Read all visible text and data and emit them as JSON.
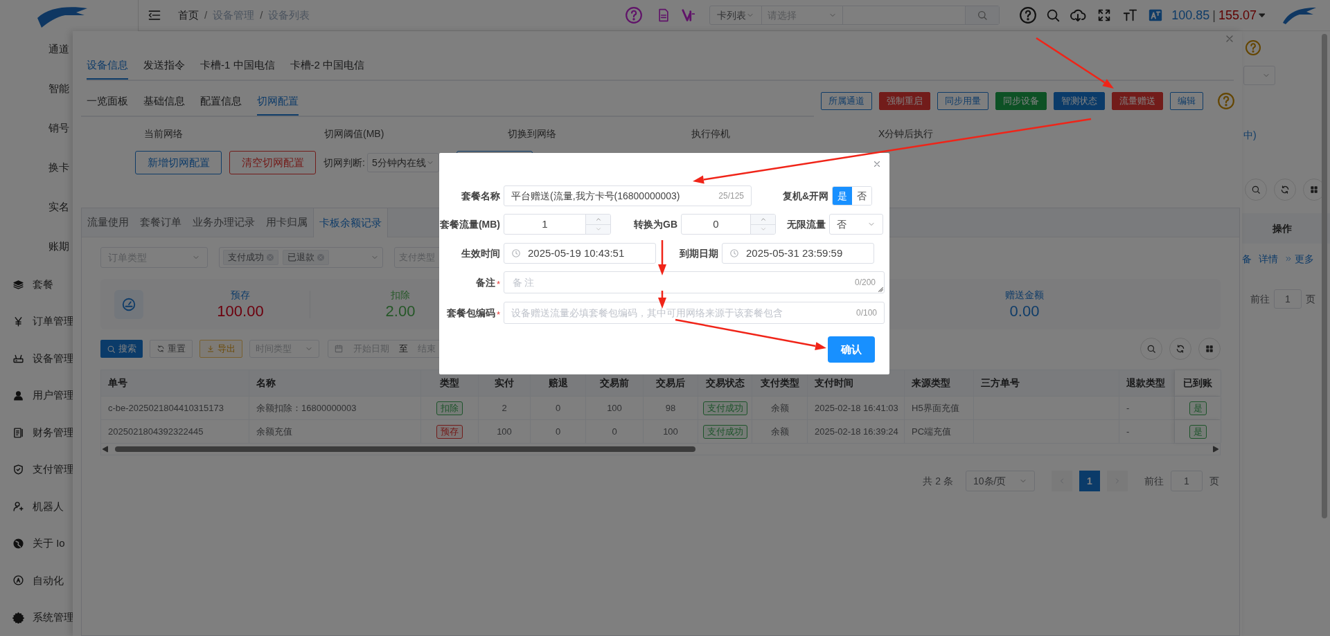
{
  "sidebar": {
    "sub_items": [
      "通道",
      "智能",
      "销号",
      "换卡",
      "实名",
      "账期"
    ],
    "items": [
      "套餐",
      "订单管理",
      "设备管理",
      "用户管理",
      "财务管理",
      "支付管理",
      "机器人",
      "关于 Io",
      "自动化",
      "系统管理"
    ]
  },
  "topbar": {
    "breadcrumb": [
      "首页",
      "设备管理",
      "设备列表"
    ],
    "breadcrumb_separator": "/",
    "search_scope": "卡列表",
    "search_select_placeholder": "请选择",
    "balance": "100.85",
    "balance_separator": "|",
    "balance_2": "155.07"
  },
  "background_page": {
    "link_text": "中)",
    "column_header": "操作",
    "row_actions": [
      "备",
      "详情",
      "更多"
    ],
    "goto_label": "前往",
    "goto_value": "1",
    "page_unit": "页"
  },
  "drawer": {
    "tabs": [
      {
        "label": "设备信息",
        "selected": true
      },
      {
        "label": "发送指令",
        "selected": false
      },
      {
        "label": "卡槽-1 中国电信",
        "selected": false
      },
      {
        "label": "卡槽-2 中国电信",
        "selected": false
      }
    ],
    "subtabs": [
      {
        "label": "一览面板",
        "selected": false
      },
      {
        "label": "基础信息",
        "selected": false
      },
      {
        "label": "配置信息",
        "selected": false
      },
      {
        "label": "切网配置",
        "selected": true
      }
    ],
    "action_buttons": [
      {
        "label": "所属通道",
        "kind": "outline"
      },
      {
        "label": "强制重启",
        "kind": "danger"
      },
      {
        "label": "同步用量",
        "kind": "outline"
      },
      {
        "label": "同步设备",
        "kind": "success"
      },
      {
        "label": "智测状态",
        "kind": "primary"
      },
      {
        "label": "流量赠送",
        "kind": "danger"
      },
      {
        "label": "编辑",
        "kind": "outline"
      }
    ],
    "switch_columns": [
      "当前网络",
      "切网阈值(MB)",
      "切换到网络",
      "执行停机",
      "X分钟后执行"
    ],
    "add_button": "新增切网配置",
    "clear_button": "清空切网配置",
    "judge_label": "切网判断:",
    "judge_value": "5分钟内在线",
    "record_tabs": [
      {
        "label": "流量使用",
        "selected": false
      },
      {
        "label": "套餐订单",
        "selected": false
      },
      {
        "label": "业务办理记录",
        "selected": false
      },
      {
        "label": "用卡归属",
        "selected": false
      },
      {
        "label": "卡板余额记录",
        "selected": true
      }
    ],
    "filters": {
      "order_type_placeholder": "订单类型",
      "status_tags": [
        "支付成功",
        "已退款"
      ],
      "pay_type_placeholder": "支付类型"
    },
    "stats": [
      {
        "label": "预存",
        "value": "100.00",
        "kind": "deposit"
      },
      {
        "label": "扣除",
        "value": "2.00",
        "kind": "deduct"
      },
      {
        "label": "赠送金额",
        "value": "0.00",
        "kind": "gift"
      }
    ],
    "toolbar": {
      "search_button": "搜索",
      "reset_button": "重置",
      "export_button": "导出",
      "time_type_placeholder": "时间类型",
      "start_placeholder": "开始日期",
      "range_separator": "至",
      "end_placeholder": "结束"
    },
    "table": {
      "columns": [
        "单号",
        "名称",
        "类型",
        "实付",
        "赔退",
        "交易前",
        "交易后",
        "交易状态",
        "支付类型",
        "支付时间",
        "来源类型",
        "三方单号",
        "退款类型",
        "已到账"
      ],
      "rows": [
        [
          {
            "text": "c-be-2025021804410315173"
          },
          {
            "text": "余额扣除：16800000003"
          },
          {
            "text": "扣除",
            "kind": "success_tag"
          },
          {
            "text": "2"
          },
          {
            "text": "0"
          },
          {
            "text": "100"
          },
          {
            "text": "98"
          },
          {
            "text": "支付成功",
            "kind": "success_tag"
          },
          {
            "text": "余额"
          },
          {
            "text": "2025-02-18 16:41:03"
          },
          {
            "text": "H5界面充值"
          },
          {
            "text": ""
          },
          {
            "text": "-"
          },
          {
            "text": "是",
            "kind": "success_tag"
          }
        ],
        [
          {
            "text": "2025021804392322445"
          },
          {
            "text": "余额充值"
          },
          {
            "text": "预存",
            "kind": "danger_tag"
          },
          {
            "text": "100"
          },
          {
            "text": "0"
          },
          {
            "text": "0"
          },
          {
            "text": "100"
          },
          {
            "text": "支付成功",
            "kind": "success_tag"
          },
          {
            "text": "余额"
          },
          {
            "text": "2025-02-18 16:39:24"
          },
          {
            "text": "PC端充值"
          },
          {
            "text": ""
          },
          {
            "text": "-"
          },
          {
            "text": "是",
            "kind": "success_tag"
          }
        ]
      ]
    },
    "pagination": {
      "total": "共 2 条",
      "page_size": "10条/页",
      "pages": [
        {
          "label": "1",
          "selected": true
        }
      ],
      "goto_label": "前往",
      "goto_value": "1",
      "page_unit": "页"
    }
  },
  "dialog": {
    "name_label": "套餐名称",
    "name_value": "平台赠送(流量,我方卡号(16800000003)",
    "name_count": "25/125",
    "reopen_label": "复机&开网",
    "reopen_options": [
      {
        "label": "是",
        "selected": true
      },
      {
        "label": "否",
        "selected": false
      }
    ],
    "flow_label": "套餐流量(MB)",
    "flow_value": "1",
    "gb_label": "转换为GB",
    "gb_value": "0",
    "unlimited_label": "无限流量",
    "unlimited_value": "否",
    "start_label": "生效时间",
    "start_value": "2025-05-19 10:43:51",
    "end_label": "到期日期",
    "end_value": "2025-05-31 23:59:59",
    "remark_label": "备注",
    "remark_required_mark": "*",
    "remark_placeholder": "备注",
    "remark_count": "0/200",
    "code_label": "套餐包编码",
    "code_required_mark": "*",
    "code_placeholder": "设备赠送流量必填套餐包编码，其中可用网络来源于该套餐包含",
    "code_count": "0/100",
    "confirm_button": "确认"
  }
}
